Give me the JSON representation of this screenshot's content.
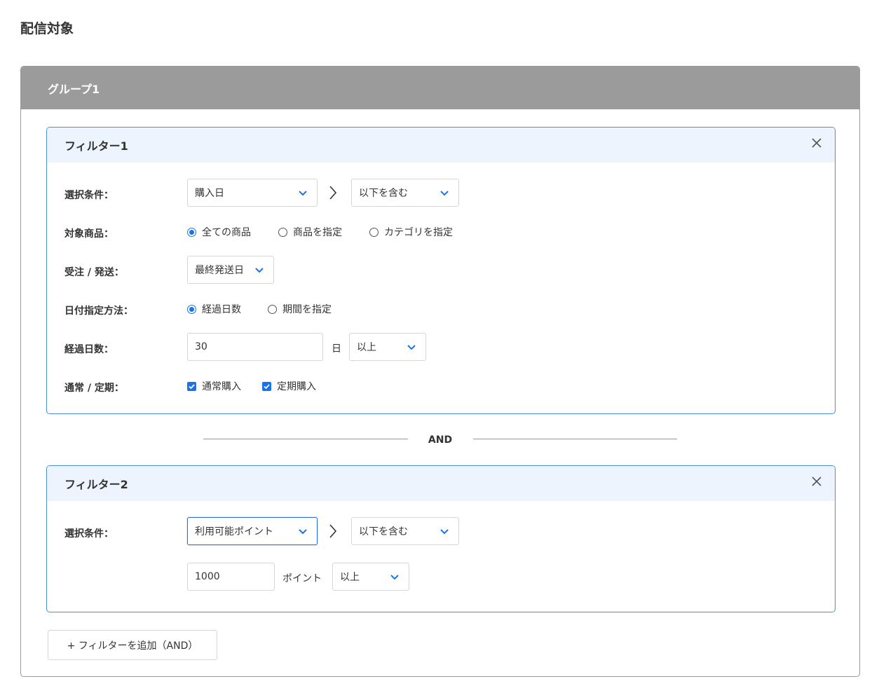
{
  "page": {
    "title": "配信対象"
  },
  "group": {
    "title": "グループ1"
  },
  "filter1": {
    "title": "フィルター1",
    "labels": {
      "condition": "選択条件：",
      "product": "対象商品：",
      "order": "受注 / 発送：",
      "date_method": "日付指定方法：",
      "days": "経過日数：",
      "type": "通常 / 定期："
    },
    "condition_select": "購入日",
    "operator_select": "以下を含む",
    "product_options": [
      {
        "label": "全ての商品",
        "selected": true
      },
      {
        "label": "商品を指定",
        "selected": false
      },
      {
        "label": "カテゴリを指定",
        "selected": false
      }
    ],
    "order_select": "最終発送日",
    "date_method_options": [
      {
        "label": "経過日数",
        "selected": true
      },
      {
        "label": "期間を指定",
        "selected": false
      }
    ],
    "days_value": "30",
    "days_unit": "日",
    "days_comparator": "以上",
    "type_options": [
      {
        "label": "通常購入",
        "checked": true
      },
      {
        "label": "定期購入",
        "checked": true
      }
    ]
  },
  "and_label": "AND",
  "filter2": {
    "title": "フィルター2",
    "labels": {
      "condition": "選択条件："
    },
    "condition_select": "利用可能ポイント",
    "operator_select": "以下を含む",
    "points_value": "1000",
    "points_unit": "ポイント",
    "points_comparator": "以上"
  },
  "add_filter_label": "+ フィルターを追加（AND）",
  "colors": {
    "accent": "#1a73e8",
    "group_header": "#9b9b9b",
    "filter_border": "#4a90d9",
    "filter_header": "#eef4fd"
  },
  "icons": {
    "close": "close-icon",
    "chevron": "chevron-down-icon",
    "arrow": "chevron-right-icon",
    "check": "check-icon"
  }
}
